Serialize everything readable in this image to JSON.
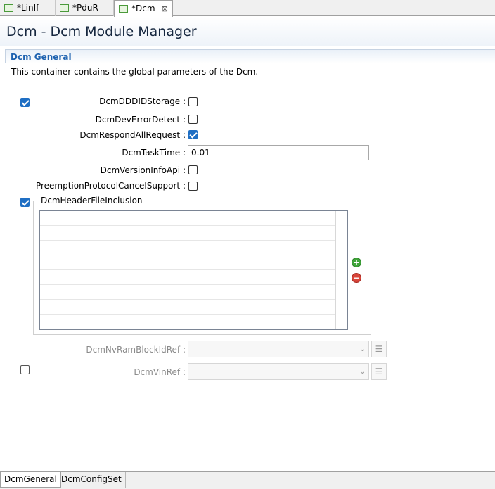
{
  "tabs": [
    {
      "label": "*LinIf",
      "icon": "config-file-icon"
    },
    {
      "label": "*PduR",
      "icon": "config-file-icon"
    },
    {
      "label": "*Dcm",
      "icon": "config-file-icon",
      "close": "⊠"
    }
  ],
  "page_title": "Dcm - Dcm Module Manager",
  "section": {
    "title": "Dcm General",
    "description": "This container contains the global parameters of the Dcm."
  },
  "params": {
    "ddd_storage": {
      "label": "DcmDDDIDStorage :",
      "checked": false
    },
    "dev_error": {
      "label": "DcmDevErrorDetect :",
      "checked": false
    },
    "respond_all": {
      "label": "DcmRespondAllRequest :",
      "checked": true
    },
    "task_time": {
      "label": "DcmTaskTime :",
      "value": "0.01"
    },
    "version_info": {
      "label": "DcmVersionInfoApi :",
      "checked": false
    },
    "preemption": {
      "label": "PreemptionProtocolCancelSupport :",
      "checked": false
    }
  },
  "header_file_inclusion": {
    "label": "DcmHeaderFileInclusion",
    "enabled": true,
    "rows": 8
  },
  "nvram_ref": {
    "label": "DcmNvRamBlockIdRef :",
    "value": ""
  },
  "vin_ref": {
    "label": "DcmVinRef :",
    "value": "",
    "enabled": false
  },
  "bottom_tabs": [
    "DcmGeneral",
    "DcmConfigSet"
  ],
  "colors": {
    "accent": "#1f6fc4",
    "section_title": "#1f63b0"
  }
}
